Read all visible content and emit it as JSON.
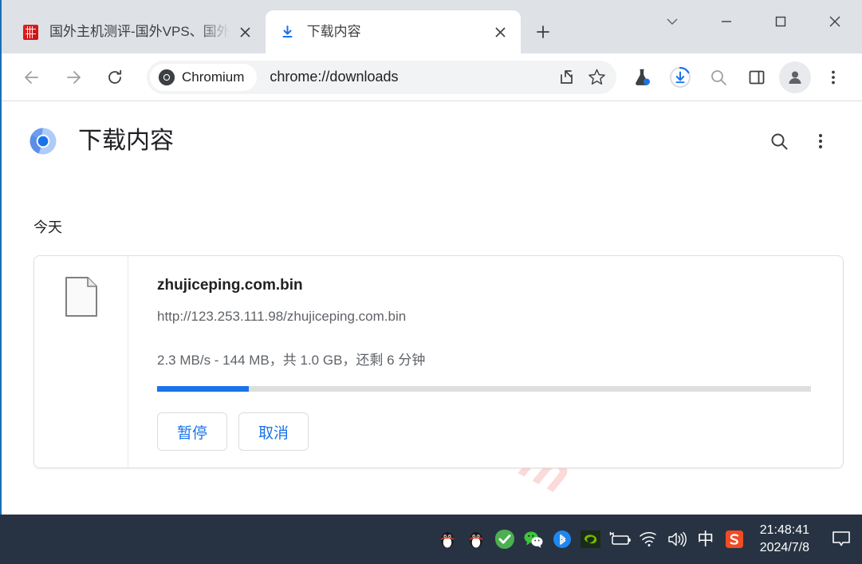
{
  "browser": {
    "tabs": [
      {
        "title": "国外主机测评-国外VPS、国外",
        "favicon": "seal-icon",
        "active": false
      },
      {
        "title": "下载内容",
        "favicon": "download-icon",
        "active": true
      }
    ],
    "new_tab_label": "+",
    "window_controls": [
      "tab-search-chevron",
      "minimize",
      "maximize",
      "close"
    ],
    "toolbar": {
      "back": "back-arrow",
      "forward": "forward-arrow",
      "reload": "reload",
      "chip_label": "Chromium",
      "url": "chrome://downloads",
      "share": "share-icon",
      "bookmark": "star-icon",
      "icons": [
        "flask-icon",
        "download-progress-icon",
        "search-icon",
        "side-panel-icon",
        "profile-avatar",
        "three-dot-menu"
      ]
    }
  },
  "downloads_page": {
    "title": "下载内容",
    "search_icon": "search-icon",
    "menu_icon": "three-dot-menu",
    "date_group": "今天",
    "watermark": "zhujiceping.com",
    "item": {
      "file_name": "zhujiceping.com.bin",
      "url": "http://123.253.111.98/zhujiceping.com.bin",
      "status": "2.3 MB/s - 144 MB，共 1.0 GB，还剩 6 分钟",
      "progress_percent": 14,
      "pause_label": "暂停",
      "cancel_label": "取消"
    }
  },
  "taskbar": {
    "tray_icons": [
      "qq-penguin-icon",
      "qq-penguin-icon",
      "green-check-icon",
      "wechat-icon",
      "bluetooth-icon",
      "nvidia-icon",
      "battery-icon",
      "wifi-icon",
      "volume-icon",
      "ime-chinese-icon",
      "sogou-icon"
    ],
    "ime_label": "中",
    "sogou_label": "S",
    "time": "21:48:41",
    "date": "2024/7/8",
    "notification_icon": "notification-bubble-icon"
  },
  "colors": {
    "accent_blue": "#1a73e8",
    "tabstrip_bg": "#dee1e6",
    "taskbar_bg": "#273342",
    "watermark_pink": "#fbdada"
  }
}
